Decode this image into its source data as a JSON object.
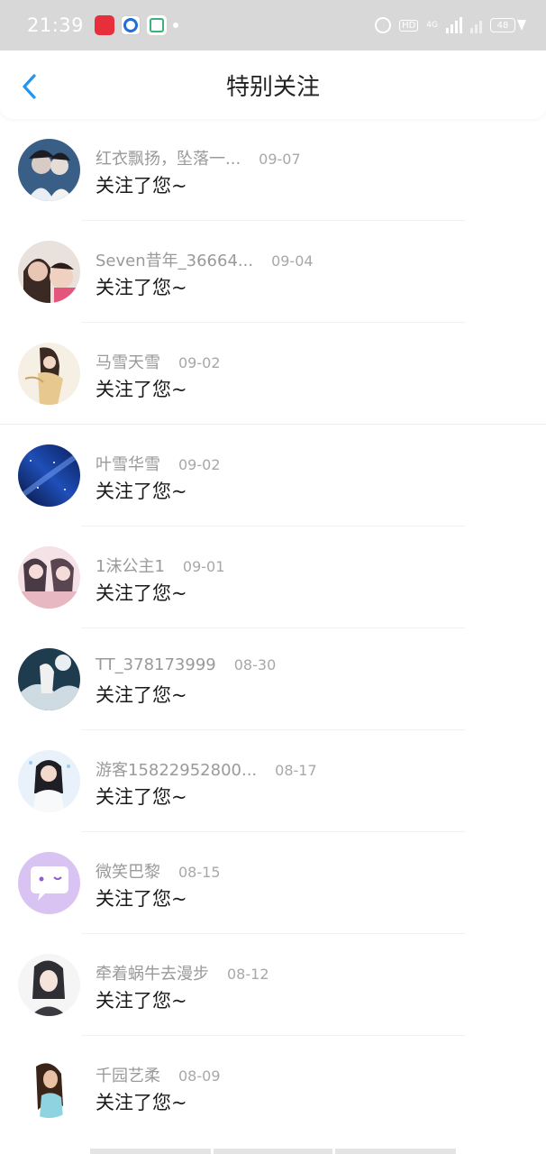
{
  "status_bar": {
    "time": "21:39",
    "hd_label": "HD",
    "network_label": "4G",
    "battery_level": "48",
    "apps": [
      "red-app-icon",
      "blue-app-icon",
      "green-app-icon"
    ]
  },
  "header": {
    "title": "特别关注",
    "back_icon": "chevron-left-icon",
    "accent_color": "#2196f3"
  },
  "items": [
    {
      "name": "红衣飘扬，坠落一...",
      "date": "09-07",
      "action": "关注了您~",
      "avatar": "avatar-1"
    },
    {
      "name": "Seven昔年_36664...",
      "date": "09-04",
      "action": "关注了您~",
      "avatar": "avatar-2"
    },
    {
      "name": "马雪天雪",
      "date": "09-02",
      "action": "关注了您~",
      "avatar": "avatar-3"
    },
    {
      "name": "叶雪华雪",
      "date": "09-02",
      "action": "关注了您~",
      "avatar": "avatar-4"
    },
    {
      "name": "1沫公主1",
      "date": "09-01",
      "action": "关注了您~",
      "avatar": "avatar-5"
    },
    {
      "name": "TT_378173999",
      "date": "08-30",
      "action": "关注了您~",
      "avatar": "avatar-6"
    },
    {
      "name": "游客15822952800...",
      "date": "08-17",
      "action": "关注了您~",
      "avatar": "avatar-7"
    },
    {
      "name": "微笑巴黎",
      "date": "08-15",
      "action": "关注了您~",
      "avatar": "avatar-8"
    },
    {
      "name": "牵着蜗牛去漫步",
      "date": "08-12",
      "action": "关注了您~",
      "avatar": "avatar-9"
    },
    {
      "name": "千园艺柔",
      "date": "08-09",
      "action": "关注了您~",
      "avatar": "avatar-10"
    }
  ]
}
